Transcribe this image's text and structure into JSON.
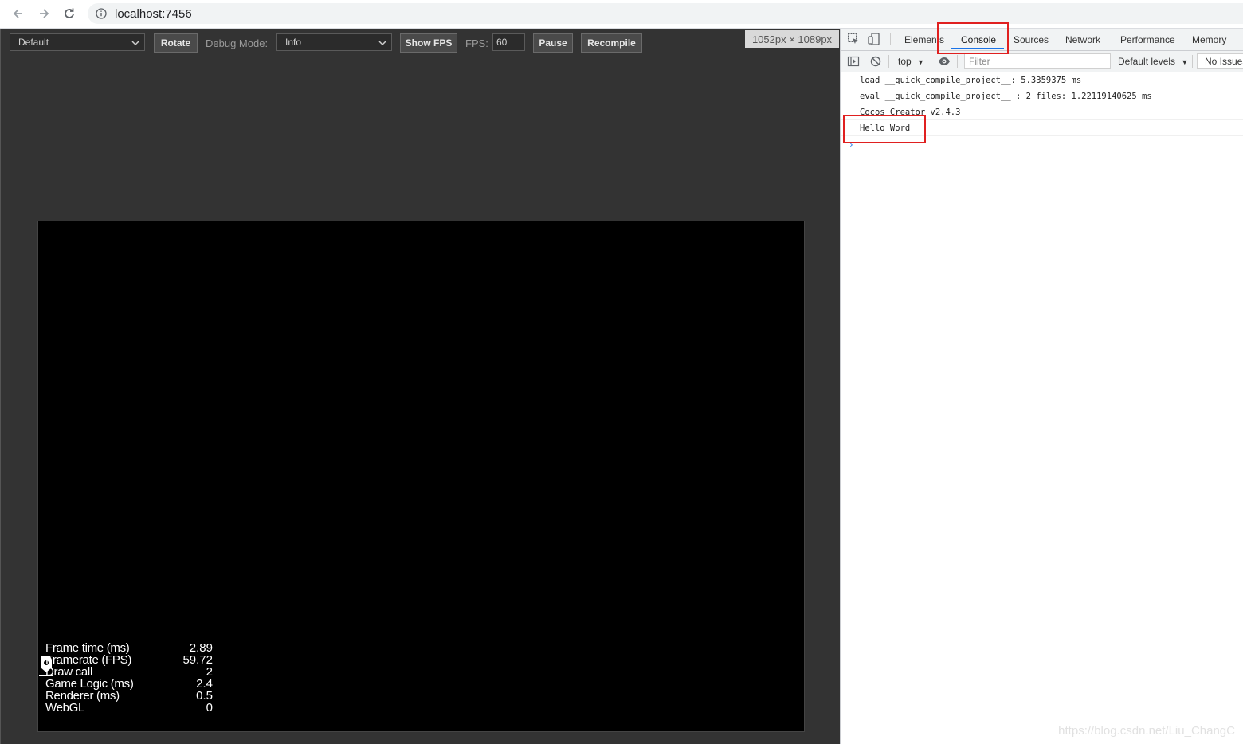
{
  "browser": {
    "url": "localhost:7456"
  },
  "toolbar": {
    "device_select": "Default",
    "rotate_label": "Rotate",
    "debug_mode_label": "Debug Mode:",
    "debug_mode_value": "Info",
    "show_fps_label": "Show FPS",
    "fps_label": "FPS:",
    "fps_value": "60",
    "pause_label": "Pause",
    "recompile_label": "Recompile",
    "size_badge": "1052px × 1089px"
  },
  "stats": [
    {
      "label": "Frame time (ms)",
      "value": "2.89"
    },
    {
      "label": "Framerate (FPS)",
      "value": "59.72"
    },
    {
      "label": "Draw call",
      "value": "2"
    },
    {
      "label": "Game Logic (ms)",
      "value": "2.4"
    },
    {
      "label": "Renderer (ms)",
      "value": "0.5"
    },
    {
      "label": "WebGL",
      "value": "0"
    }
  ],
  "devtools": {
    "tabs": [
      "Elements",
      "Console",
      "Sources",
      "Network",
      "Performance",
      "Memory"
    ],
    "active_tab": "Console",
    "context": "top",
    "filter_placeholder": "Filter",
    "levels": "Default levels",
    "issues": "No Issues",
    "messages": [
      "load __quick_compile_project__: 5.3359375 ms",
      "eval __quick_compile_project__ : 2 files: 1.22119140625 ms",
      "Cocos Creator v2.4.3",
      "Hello Word"
    ],
    "prompt": "›"
  },
  "watermark": "https://blog.csdn.net/Liu_ChangC",
  "colors": {
    "highlight": "#e02020",
    "accent": "#1a73e8",
    "preview_bg": "#333333",
    "canvas_bg": "#000000"
  }
}
